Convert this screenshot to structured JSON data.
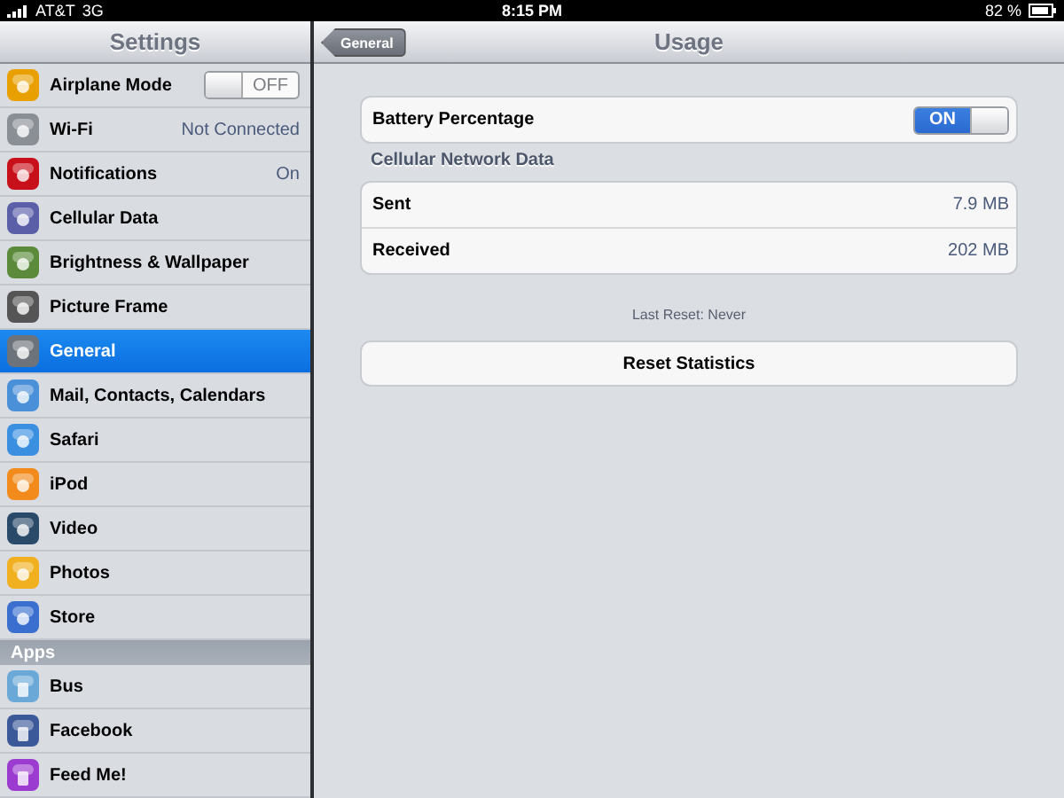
{
  "status_bar": {
    "carrier": "AT&T",
    "network": "3G",
    "time": "8:15 PM",
    "battery": "82 %"
  },
  "sidebar": {
    "title": "Settings",
    "items": [
      {
        "label": "Airplane Mode",
        "kind": "toggle",
        "selected": false,
        "switch": {
          "on": false,
          "label": "OFF"
        }
      },
      {
        "label": "Wi-Fi",
        "kind": "value",
        "selected": false,
        "value": "Not Connected"
      },
      {
        "label": "Notifications",
        "kind": "value",
        "selected": false,
        "value": "On"
      },
      {
        "label": "Cellular Data",
        "kind": "plain",
        "selected": false
      },
      {
        "label": "Brightness & Wallpaper",
        "kind": "plain",
        "selected": false
      },
      {
        "label": "Picture Frame",
        "kind": "plain",
        "selected": false
      },
      {
        "label": "General",
        "kind": "plain",
        "selected": true
      },
      {
        "label": "Mail, Contacts, Calendars",
        "kind": "plain",
        "selected": false
      },
      {
        "label": "Safari",
        "kind": "plain",
        "selected": false
      },
      {
        "label": "iPod",
        "kind": "plain",
        "selected": false
      },
      {
        "label": "Video",
        "kind": "plain",
        "selected": false
      },
      {
        "label": "Photos",
        "kind": "plain",
        "selected": false
      },
      {
        "label": "Store",
        "kind": "plain",
        "selected": false
      }
    ],
    "apps_header": "Apps",
    "apps": [
      {
        "label": "Bus",
        "selected": false
      },
      {
        "label": "Facebook",
        "selected": false
      },
      {
        "label": "Feed Me!",
        "selected": false
      }
    ]
  },
  "detail": {
    "back": "General",
    "title": "Usage",
    "battery_row": {
      "label": "Battery Percentage",
      "switch": {
        "on": true,
        "label": "ON"
      }
    },
    "section": "Cellular Network Data",
    "rows": [
      {
        "label": "Sent",
        "value": "7.9 MB"
      },
      {
        "label": "Received",
        "value": "202 MB"
      }
    ],
    "footer": "Last Reset: Never",
    "button": "Reset Statistics"
  }
}
